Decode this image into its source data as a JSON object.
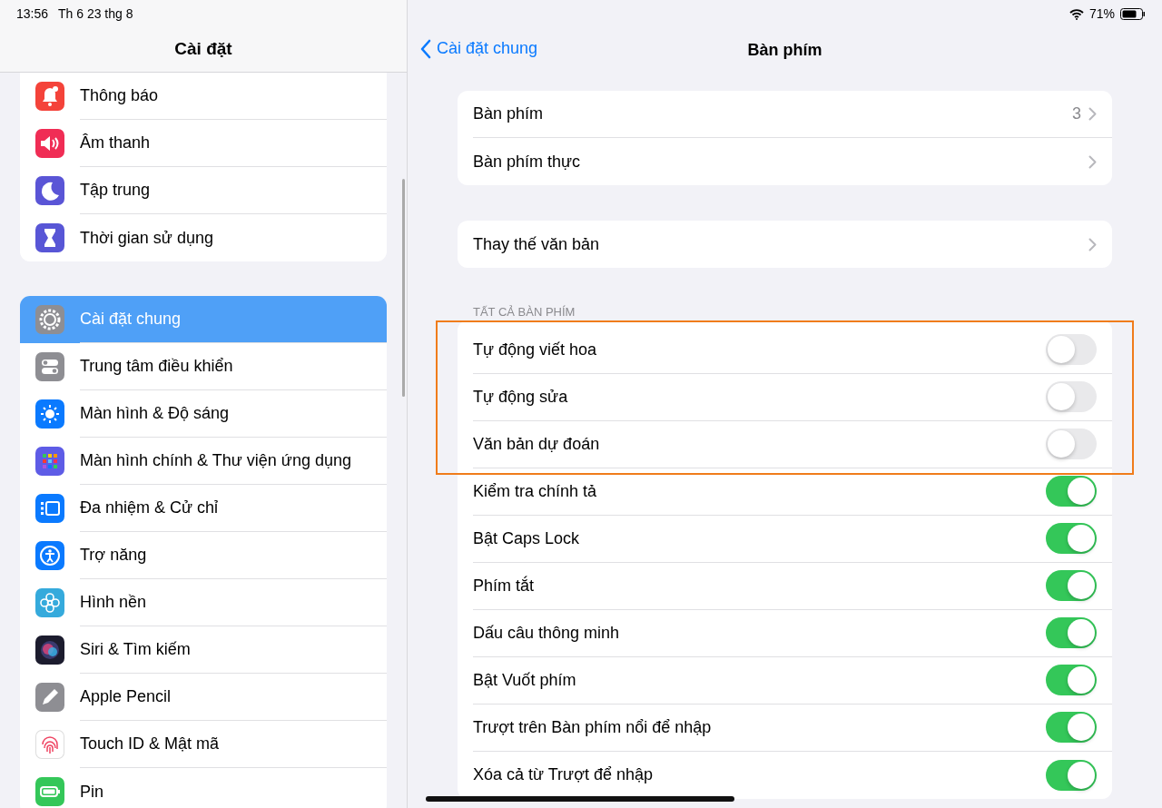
{
  "status_bar": {
    "time": "13:56",
    "date": "Th 6 23 thg 8",
    "battery": "71%"
  },
  "sidebar": {
    "title": "Cài đặt",
    "groups": [
      {
        "items": [
          {
            "label": "Thông báo",
            "color": "#f4433a",
            "selected": false
          },
          {
            "label": "Âm thanh",
            "color": "#f02d55",
            "selected": false
          },
          {
            "label": "Tập trung",
            "color": "#5a55d6",
            "selected": false
          },
          {
            "label": "Thời gian sử dụng",
            "color": "#5856d6",
            "selected": false
          }
        ]
      },
      {
        "items": [
          {
            "label": "Cài đặt chung",
            "color": "#8e8e93",
            "selected": true
          },
          {
            "label": "Trung tâm điều khiển",
            "color": "#8e8e93",
            "selected": false
          },
          {
            "label": "Màn hình & Độ sáng",
            "color": "#0a7aff",
            "selected": false
          },
          {
            "label": "Màn hình chính & Thư viện ứng dụng",
            "color": "#5e5ce6",
            "selected": false
          },
          {
            "label": "Đa nhiệm & Cử chỉ",
            "color": "#0a7aff",
            "selected": false
          },
          {
            "label": "Trợ năng",
            "color": "#0a7aff",
            "selected": false
          },
          {
            "label": "Hình nền",
            "color": "#35aadc",
            "selected": false
          },
          {
            "label": "Siri & Tìm kiếm",
            "color": "#1c1c2e",
            "selected": false
          },
          {
            "label": "Apple Pencil",
            "color": "#8e8e93",
            "selected": false
          },
          {
            "label": "Touch ID & Mật mã",
            "color": "#ffffff",
            "selected": false
          },
          {
            "label": "Pin",
            "color": "#34c759",
            "selected": false
          }
        ]
      }
    ]
  },
  "detail": {
    "back": "Cài đặt chung",
    "title": "Bàn phím",
    "groups": [
      {
        "rows": [
          {
            "label": "Bàn phím",
            "value": "3",
            "kind": "link"
          },
          {
            "label": "Bàn phím thực",
            "kind": "link"
          }
        ]
      },
      {
        "rows": [
          {
            "label": "Thay thế văn bản",
            "kind": "link"
          }
        ]
      },
      {
        "header": "TẤT CẢ BÀN PHÍM",
        "rows": [
          {
            "label": "Tự động viết hoa",
            "kind": "toggle",
            "on": false,
            "highlighted": true
          },
          {
            "label": "Tự động sửa",
            "kind": "toggle",
            "on": false,
            "highlighted": true
          },
          {
            "label": "Văn bản dự đoán",
            "kind": "toggle",
            "on": false,
            "highlighted": true
          },
          {
            "label": "Kiểm tra chính tả",
            "kind": "toggle",
            "on": true,
            "highlighted": false
          },
          {
            "label": "Bật Caps Lock",
            "kind": "toggle",
            "on": true,
            "highlighted": false
          },
          {
            "label": "Phím tắt",
            "kind": "toggle",
            "on": true,
            "highlighted": false
          },
          {
            "label": "Dấu câu thông minh",
            "kind": "toggle",
            "on": true,
            "highlighted": false
          },
          {
            "label": "Bật Vuốt phím",
            "kind": "toggle",
            "on": true,
            "highlighted": false
          },
          {
            "label": "Trượt trên Bàn phím nổi để nhập",
            "kind": "toggle",
            "on": true,
            "highlighted": false
          },
          {
            "label": "Xóa cả từ Trượt để nhập",
            "kind": "toggle",
            "on": true,
            "highlighted": false
          }
        ]
      }
    ]
  }
}
